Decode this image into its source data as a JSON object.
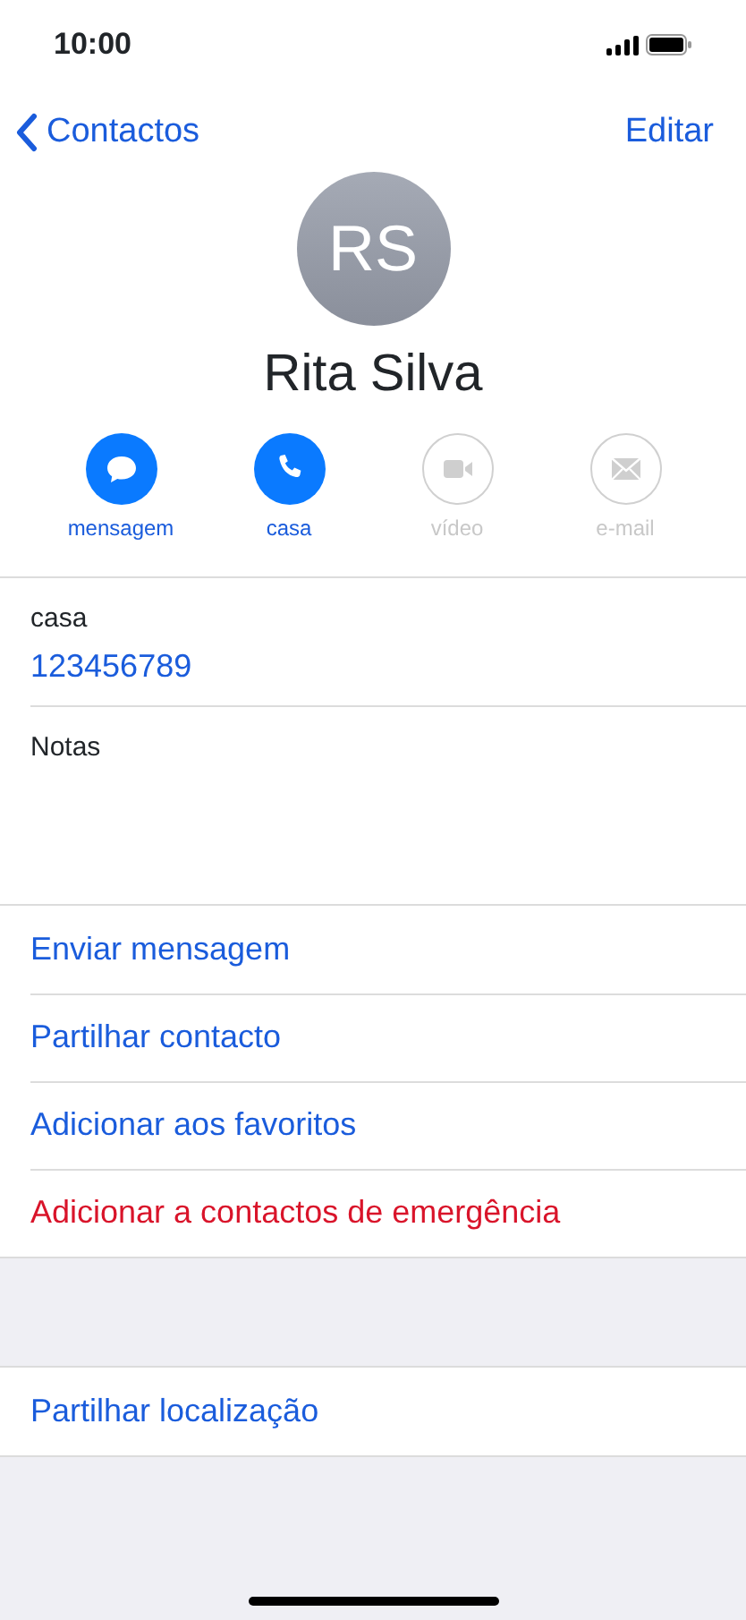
{
  "status_bar": {
    "time": "10:00"
  },
  "nav": {
    "back": "Contactos",
    "action": "Editar"
  },
  "contact": {
    "initials": "RS",
    "name": "Rita Silva"
  },
  "actions": [
    {
      "kind": "message",
      "label": "mensagem",
      "disabled": false
    },
    {
      "kind": "phone",
      "label": "casa",
      "disabled": false
    },
    {
      "kind": "video",
      "label": "vídeo",
      "disabled": true
    },
    {
      "kind": "mail",
      "label": "e-mail",
      "disabled": true
    }
  ],
  "phone": {
    "label": "casa",
    "number": "123456789"
  },
  "notes": {
    "label": "Notas"
  },
  "links": [
    {
      "label": "Enviar mensagem",
      "kind": "normal"
    },
    {
      "label": "Partilhar contacto",
      "kind": "normal"
    },
    {
      "label": "Adicionar aos favoritos",
      "kind": "normal"
    },
    {
      "label": "Adicionar a contactos de emergência",
      "kind": "destructive"
    }
  ],
  "location": {
    "label": "Partilhar localização"
  }
}
